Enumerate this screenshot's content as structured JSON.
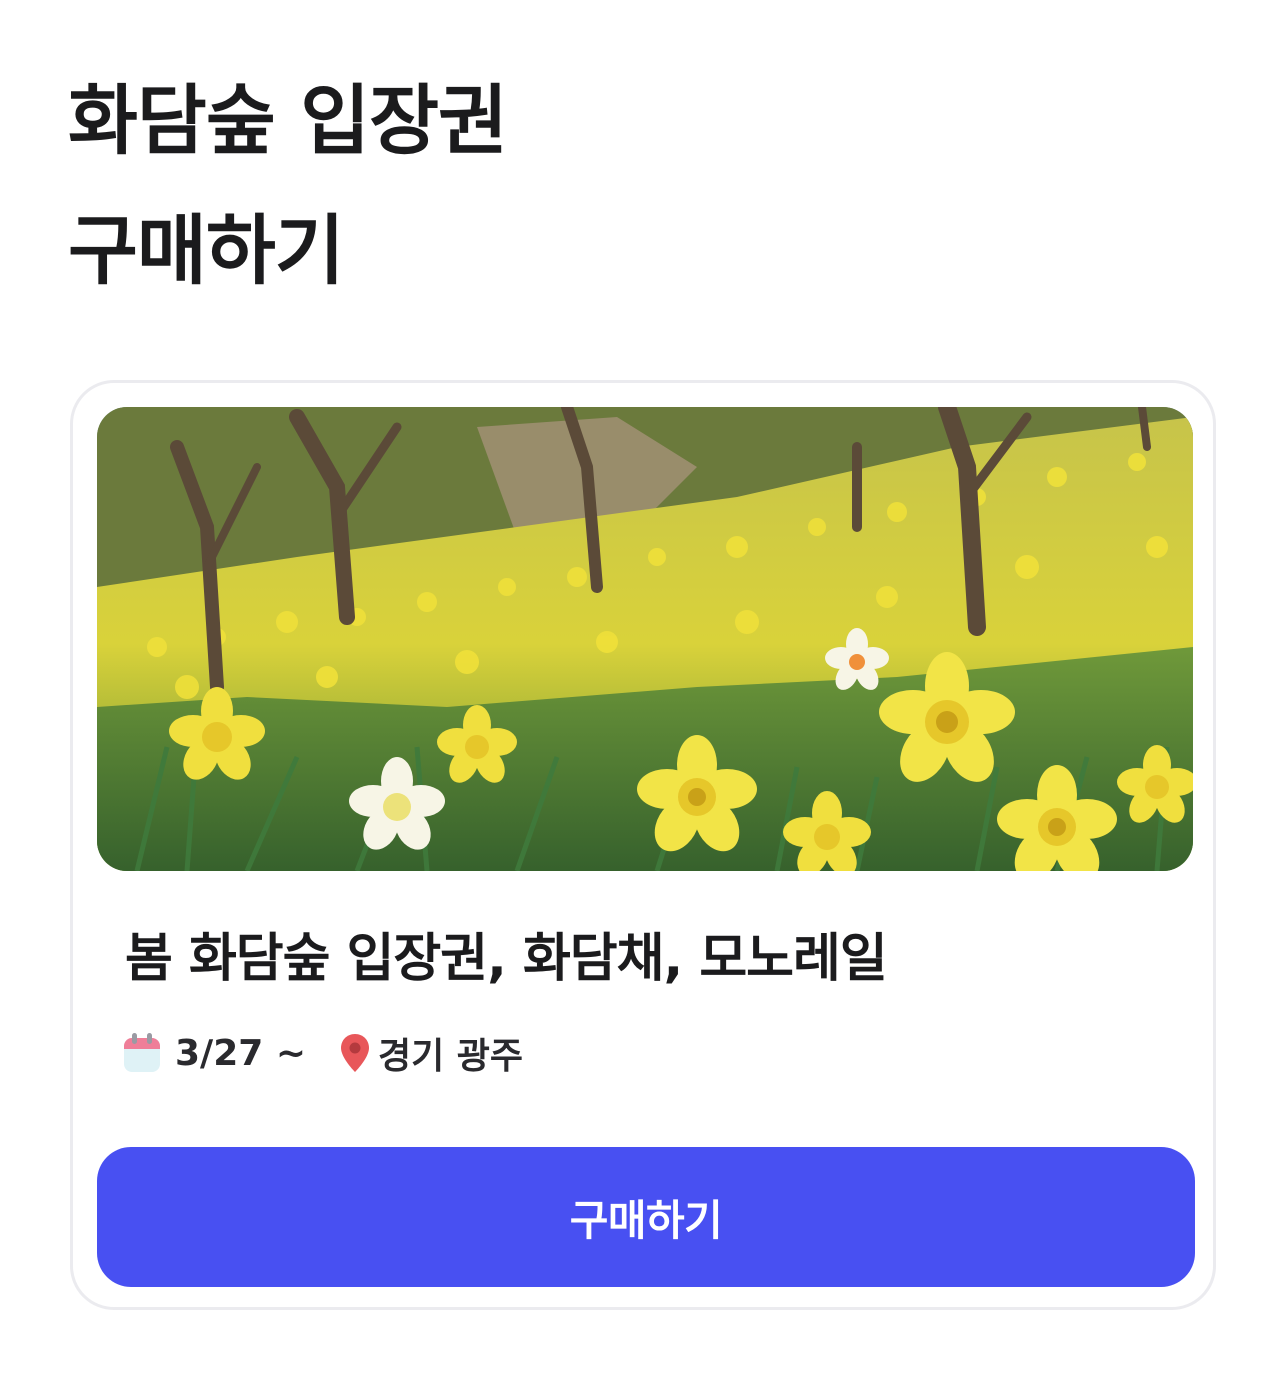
{
  "page": {
    "title_line1": "화담숲 입장권",
    "title_line2": "구매하기"
  },
  "card": {
    "image_alt": "화담숲 수선화 언덕",
    "event_title": "봄 화담숲 입장권, 화담채, 모노레일",
    "date": "3/27 ~",
    "date_icon": "calendar-icon",
    "location": "경기 광주",
    "location_icon": "map-pin-icon",
    "buy_button_label": "구매하기"
  },
  "colors": {
    "accent": "#4850f2",
    "card_border": "#ebebef",
    "text": "#1b1b1d",
    "pin": "#e8575a"
  }
}
